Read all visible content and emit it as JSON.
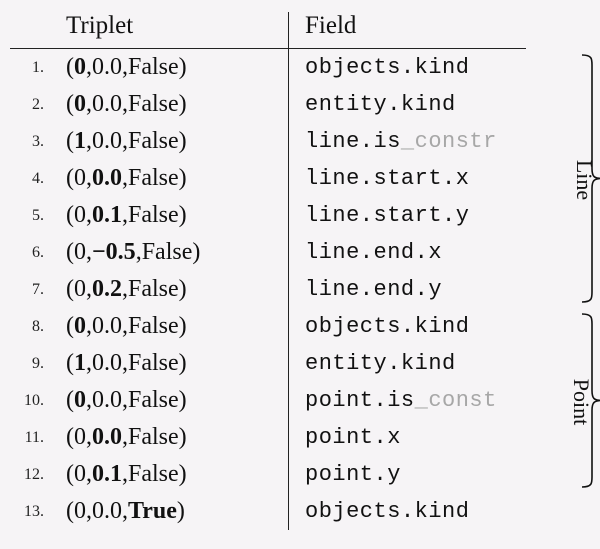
{
  "headers": {
    "triplet": "Triplet",
    "field": "Field"
  },
  "rows": [
    {
      "idx": "1.",
      "t_open": "(",
      "a": "0",
      "a_bold": true,
      "b": "0.0",
      "b_bold": false,
      "c": "False",
      "c_bold": false,
      "t_close": ")",
      "field_main": "objects.kind",
      "field_dim": ""
    },
    {
      "idx": "2.",
      "t_open": "(",
      "a": "0",
      "a_bold": true,
      "b": "0.0",
      "b_bold": false,
      "c": "False",
      "c_bold": false,
      "t_close": ")",
      "field_main": "entity.kind",
      "field_dim": ""
    },
    {
      "idx": "3.",
      "t_open": "(",
      "a": "1",
      "a_bold": true,
      "b": "0.0",
      "b_bold": false,
      "c": "False",
      "c_bold": false,
      "t_close": ")",
      "field_main": "line.is",
      "field_dim": "_constr"
    },
    {
      "idx": "4.",
      "t_open": "(",
      "a": "0",
      "a_bold": false,
      "b": "0.0",
      "b_bold": true,
      "c": "False",
      "c_bold": false,
      "t_close": ")",
      "field_main": "line.start.x",
      "field_dim": ""
    },
    {
      "idx": "5.",
      "t_open": "(",
      "a": "0",
      "a_bold": false,
      "b": "0.1",
      "b_bold": true,
      "c": "False",
      "c_bold": false,
      "t_close": ")",
      "field_main": "line.start.y",
      "field_dim": ""
    },
    {
      "idx": "6.",
      "t_open": "(",
      "a": "0",
      "a_bold": false,
      "b": "−0.5",
      "b_bold": true,
      "c": "False",
      "c_bold": false,
      "t_close": ")",
      "field_main": "line.end.x",
      "field_dim": ""
    },
    {
      "idx": "7.",
      "t_open": "(",
      "a": "0",
      "a_bold": false,
      "b": "0.2",
      "b_bold": true,
      "c": "False",
      "c_bold": false,
      "t_close": ")",
      "field_main": "line.end.y",
      "field_dim": ""
    },
    {
      "idx": "8.",
      "t_open": "(",
      "a": "0",
      "a_bold": true,
      "b": "0.0",
      "b_bold": false,
      "c": "False",
      "c_bold": false,
      "t_close": ")",
      "field_main": "objects.kind",
      "field_dim": ""
    },
    {
      "idx": "9.",
      "t_open": "(",
      "a": "1",
      "a_bold": true,
      "b": "0.0",
      "b_bold": false,
      "c": "False",
      "c_bold": false,
      "t_close": ")",
      "field_main": "entity.kind",
      "field_dim": ""
    },
    {
      "idx": "10.",
      "t_open": "(",
      "a": "0",
      "a_bold": true,
      "b": "0.0",
      "b_bold": false,
      "c": "False",
      "c_bold": false,
      "t_close": ")",
      "field_main": "point.is",
      "field_dim": "_const"
    },
    {
      "idx": "11.",
      "t_open": "(",
      "a": "0",
      "a_bold": false,
      "b": "0.0",
      "b_bold": true,
      "c": "False",
      "c_bold": false,
      "t_close": ")",
      "field_main": "point.x",
      "field_dim": ""
    },
    {
      "idx": "12.",
      "t_open": "(",
      "a": "0",
      "a_bold": false,
      "b": "0.1",
      "b_bold": true,
      "c": "False",
      "c_bold": false,
      "t_close": ")",
      "field_main": "point.y",
      "field_dim": ""
    },
    {
      "idx": "13.",
      "t_open": "(",
      "a": "0",
      "a_bold": false,
      "b": "0.0",
      "b_bold": false,
      "c": "True",
      "c_bold": true,
      "t_close": ")",
      "field_main": "objects.kind",
      "field_dim": ""
    }
  ],
  "groups": {
    "line": {
      "label": "Line",
      "from_row": 1,
      "to_row": 7
    },
    "point": {
      "label": "Point",
      "from_row": 8,
      "to_row": 12
    }
  }
}
